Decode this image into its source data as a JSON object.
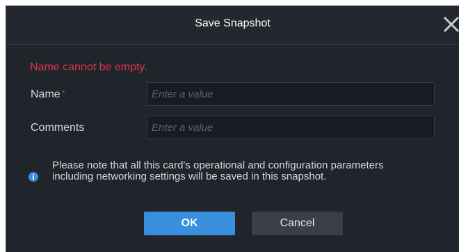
{
  "dialog": {
    "title": "Save Snapshot",
    "error_message": "Name cannot be empty.",
    "close_icon": "close-icon"
  },
  "form": {
    "name_label": "Name",
    "required_marker": "*",
    "name_placeholder": "Enter a value",
    "comments_label": "Comments",
    "comments_placeholder": "Enter a value"
  },
  "note": {
    "icon": "info-icon",
    "text": "Please note that all this card's operational and configuration parameters including networking settings will be saved in this snapshot."
  },
  "buttons": {
    "ok_label": "OK",
    "cancel_label": "Cancel"
  },
  "colors": {
    "error": "#e0344a",
    "primary": "#3a8fdc",
    "background": "#20242b"
  }
}
